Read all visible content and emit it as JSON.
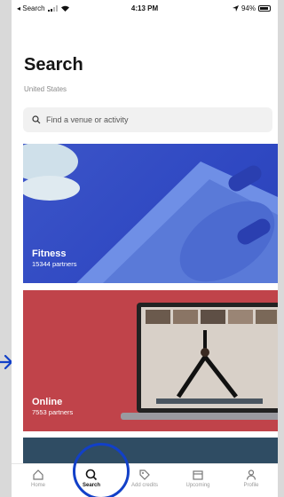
{
  "status_bar": {
    "back_label": "◂ Search",
    "time": "4:13 PM",
    "battery": "94%"
  },
  "page": {
    "title": "Search",
    "subtitle": "United States"
  },
  "search": {
    "placeholder": "Find a venue or activity"
  },
  "categories": [
    {
      "name": "Fitness",
      "count": "15344 partners"
    },
    {
      "name": "Online",
      "count": "7553 partners"
    }
  ],
  "tabbar": {
    "items": [
      {
        "label": "Home",
        "icon": "home-icon"
      },
      {
        "label": "Search",
        "icon": "search-icon",
        "active": true
      },
      {
        "label": "Add credits",
        "icon": "tag-icon"
      },
      {
        "label": "Upcoming",
        "icon": "calendar-icon"
      },
      {
        "label": "Profile",
        "icon": "person-icon"
      }
    ]
  },
  "colors": {
    "fitness_card": "#2f48c2",
    "online_card": "#c0434a",
    "highlight": "#1240c8"
  }
}
